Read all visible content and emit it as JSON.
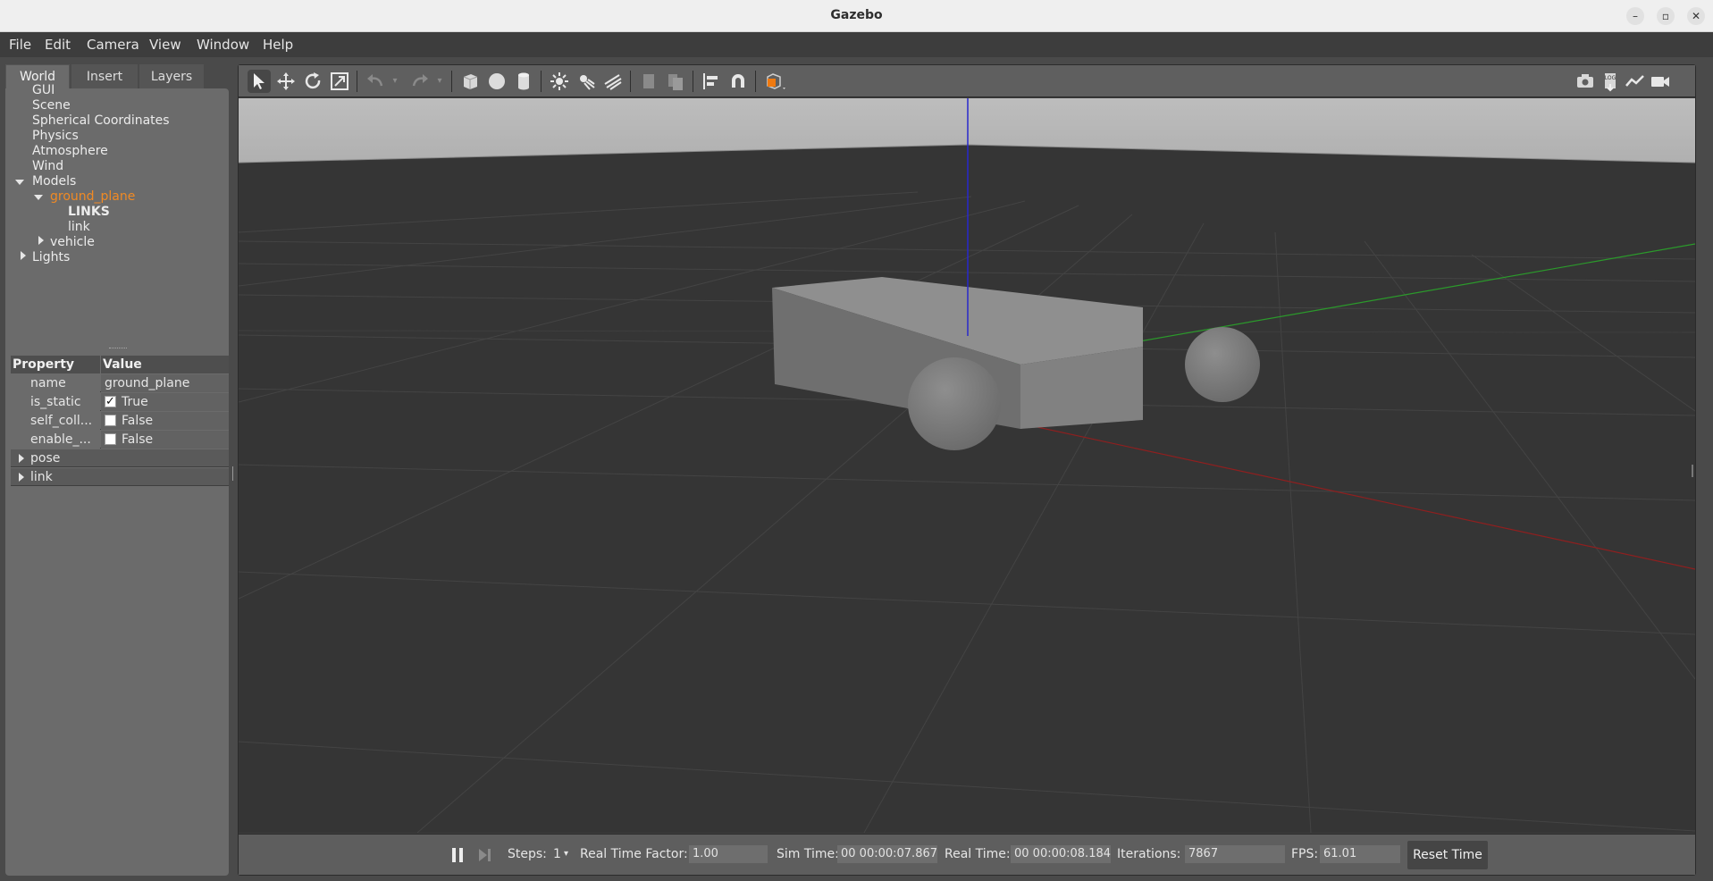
{
  "window": {
    "title": "Gazebo"
  },
  "menu": {
    "items": [
      "File",
      "Edit",
      "Camera",
      "View",
      "Window",
      "Help"
    ]
  },
  "left_panel": {
    "tabs": [
      "World",
      "Insert",
      "Layers"
    ],
    "active_tab": "World",
    "tree": {
      "gui": "GUI",
      "scene": "Scene",
      "spherical": "Spherical Coordinates",
      "physics": "Physics",
      "atmosphere": "Atmosphere",
      "wind": "Wind",
      "models": "Models",
      "ground_plane": "ground_plane",
      "links": "LINKS",
      "link": "link",
      "vehicle": "vehicle",
      "lights": "Lights"
    },
    "properties": {
      "header_property": "Property",
      "header_value": "Value",
      "rows": [
        {
          "name": "name",
          "value": "ground_plane"
        },
        {
          "name": "is_static",
          "value": "True",
          "checked": true
        },
        {
          "name": "self_coll...",
          "value": "False",
          "checked": false
        },
        {
          "name": "enable_...",
          "value": "False",
          "checked": false
        }
      ],
      "groups": [
        "pose",
        "link"
      ]
    }
  },
  "toolbar": {
    "tools": [
      "select-mode",
      "translate-mode",
      "rotate-mode",
      "scale-mode",
      "undo",
      "redo",
      "box",
      "sphere",
      "cylinder",
      "point-light",
      "spot-light",
      "directional-light",
      "copy",
      "paste",
      "align",
      "snap",
      "change-view"
    ],
    "right_tools": [
      "screenshot",
      "log",
      "plot",
      "record-video"
    ]
  },
  "bottom_bar": {
    "steps_label": "Steps:",
    "steps_value": "1",
    "rtf_label": "Real Time Factor:",
    "rtf_value": "1.00",
    "sim_time_label": "Sim Time:",
    "sim_time_value": "00 00:00:07.867",
    "real_time_label": "Real Time:",
    "real_time_value": "00 00:00:08.184",
    "iterations_label": "Iterations:",
    "iterations_value": "7867",
    "fps_label": "FPS:",
    "fps_value": "61.01",
    "reset_label": "Reset Time"
  },
  "colors": {
    "selected_tree_item": "#f08a24",
    "x_axis": "#9a1c1c",
    "y_axis": "#2a9a2a",
    "z_axis": "#2222cc"
  }
}
